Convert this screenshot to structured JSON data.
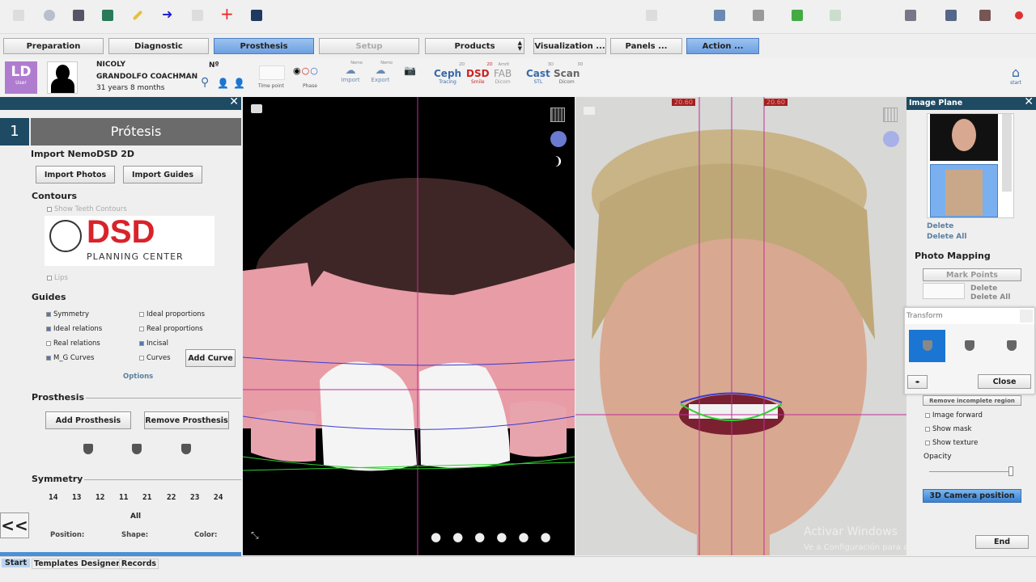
{
  "tabs": {
    "preparation": "Preparation",
    "diagnostic": "Diagnostic",
    "prosthesis": "Prosthesis",
    "setup": "Setup",
    "products": "Products",
    "visualization": "Visualization ...",
    "panels": "Panels ...",
    "action": "Action ..."
  },
  "patient": {
    "user_initials": "LD",
    "user_label": "User",
    "first_name": "NICOLY",
    "last_name": "GRANDOLFO COACHMAN",
    "age": "31 years 8 months",
    "number_label": "Nº",
    "time_point": "Time point",
    "phase": "Phase"
  },
  "tools": {
    "import": "Import",
    "import_sup": "Nemo",
    "export": "Export",
    "export_sup": "Nemo",
    "ceph": "Ceph",
    "ceph_sub": "Tracing",
    "ceph_sup": "2D",
    "dsd": "DSD",
    "dsd_sub": "Smile",
    "dsd_sup": "2D",
    "fab": "FAB",
    "fab_sub": "Dicom",
    "fab_sup": "Amrit",
    "cast": "Cast",
    "cast_sub": "STL",
    "cast_sup": "3D",
    "scan": "Scan",
    "scan_sub": "Dicom",
    "scan_sup": "3D",
    "home": "start"
  },
  "left": {
    "step": "1",
    "title": "Prótesis",
    "import_heading": "Import NemoDSD 2D",
    "import_photos": "Import Photos",
    "import_guides": "Import Guides",
    "contours": "Contours",
    "show_teeth_contours": "Show Teeth Contours",
    "logo_big": "DSD",
    "logo_small": "PLANNING CENTER",
    "lips": "Lips",
    "guides": "Guides",
    "guide_items": [
      {
        "label": "Symmetry",
        "on": true
      },
      {
        "label": "Ideal proportions",
        "on": false
      },
      {
        "label": "Ideal relations",
        "on": true
      },
      {
        "label": "Real proportions",
        "on": false
      },
      {
        "label": "Real relations",
        "on": false
      },
      {
        "label": "Incisal",
        "on": true
      },
      {
        "label": "M_G Curves",
        "on": true
      },
      {
        "label": "Curves",
        "on": false
      }
    ],
    "add_curve": "Add Curve",
    "options": "Options",
    "prosthesis": "Prosthesis",
    "add_prosthesis": "Add Prosthesis",
    "remove_prosthesis": "Remove Prosthesis",
    "symmetry": "Symmetry",
    "teeth": [
      "14",
      "13",
      "12",
      "11",
      "21",
      "22",
      "23",
      "24"
    ],
    "all": "All",
    "position": "Position:",
    "shape": "Shape:",
    "color": "Color:",
    "collapse": "<<"
  },
  "view": {
    "measure_left": "20.60",
    "measure_right": "20.60"
  },
  "right": {
    "title": "Image Plane",
    "delete": "Delete",
    "delete_all": "Delete All",
    "photo_mapping": "Photo Mapping",
    "mark_points": "Mark Points",
    "pm_delete": "Delete",
    "pm_delete_all": "Delete All",
    "transform": "Transform",
    "close": "Close",
    "hidden_btn": "Remove incomplete region",
    "image_forward": "Image forward",
    "show_mask": "Show mask",
    "show_texture": "Show texture",
    "opacity": "Opacity",
    "opacity_value": 0.97,
    "camera": "3D Camera position",
    "end": "End"
  },
  "watermark": {
    "line1": "Activar Windows",
    "line2": "Ve a Configuración para activar Windows."
  },
  "bottom": {
    "start": "Start",
    "templates": "Templates Designer",
    "records": "Records"
  }
}
